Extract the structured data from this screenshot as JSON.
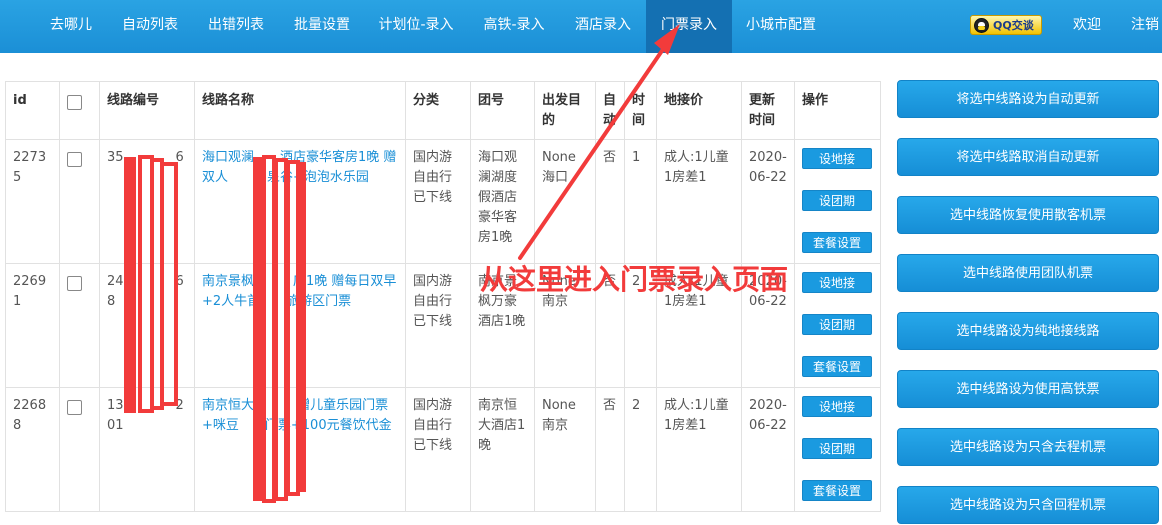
{
  "nav": {
    "items": [
      "去哪儿",
      "自动列表",
      "出错列表",
      "批量设置",
      "计划位-录入",
      "高铁-录入",
      "酒店录入",
      "门票录入",
      "小城市配置"
    ],
    "active_index": 7,
    "qq_label": "QQ交谈",
    "welcome": "欢迎",
    "logout": "注销"
  },
  "table": {
    "headers": [
      "id",
      "",
      "线路编号",
      "线路名称",
      "分类",
      "团号",
      "出发目的",
      "自动",
      "时间",
      "地接价",
      "更新时间",
      "操作"
    ],
    "rows": [
      {
        "id": "22735",
        "code": "35    6",
        "name": "海口观澜  酒店豪华客房1晚 赠双人   泉谷+泡泡水乐园",
        "category": "国内游自由行已下线",
        "group": "海口观澜湖度假酒店豪华客房1晚",
        "depart": "None海口",
        "auto": "否",
        "time": "1",
        "price": "成人:1儿童1房差1",
        "updated": "2020-06-22"
      },
      {
        "id": "22691",
        "code": "24    68",
        "name": "南京景枫   店1晚 赠每日双早+2人牛首  旅游区门票",
        "category": "国内游自由行已下线",
        "group": "南京景枫万豪酒店1晚",
        "depart": "None南京",
        "auto": "否",
        "time": "2",
        "price": "成人:1儿童1房差1",
        "updated": "2020-06-22"
      },
      {
        "id": "22688",
        "code": "13    201",
        "name": "南京恒大    赠儿童乐园门票+咪豆  门票+100元餐饮代金",
        "category": "国内游自由行已下线",
        "group": "南京恒大酒店1晚",
        "depart": "None南京",
        "auto": "否",
        "time": "2",
        "price": "成人:1儿童1房差1",
        "updated": "2020-06-22"
      }
    ],
    "ops": [
      "设地接",
      "设团期",
      "套餐设置"
    ]
  },
  "side_buttons": [
    "将选中线路设为自动更新",
    "将选中线路取消自动更新",
    "选中线路恢复使用散客机票",
    "选中线路使用团队机票",
    "选中线路设为纯地接线路",
    "选中线路设为使用高铁票",
    "选中线路设为只含去程机票",
    "选中线路设为只含回程机票"
  ],
  "annotation": {
    "text": "从这里进入门票录入页面",
    "color": "#f23b3b"
  },
  "colors": {
    "nav_bg": "#1b8fd6",
    "nav_active": "#1470b2",
    "link": "#1a8fd6",
    "button": "#1a9ae0"
  }
}
